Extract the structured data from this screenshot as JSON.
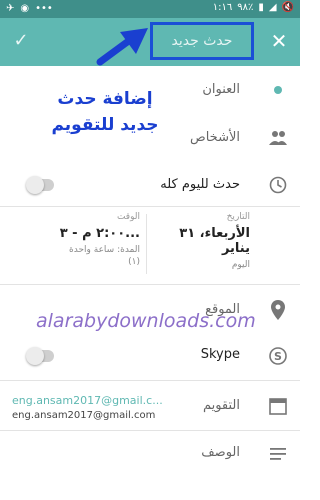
{
  "status_bar": {
    "time": "١:١٦",
    "battery": "٩٨٪"
  },
  "toolbar": {
    "title": "حدث جديد"
  },
  "annotation": {
    "line1": "إضافة حدث",
    "line2": "جديد للتقويم"
  },
  "fields": {
    "title_label": "العنوان",
    "people_label": "الأشخاص",
    "all_day_label": "حدث لليوم كله",
    "location_label": "الموقع",
    "skype_label": "Skype",
    "calendar_label": "التقويم",
    "description_label": "الوصف"
  },
  "datetime": {
    "date_caption": "التاريخ",
    "date_value": "الأربعاء، ٣١ يناير",
    "day_caption": "اليوم",
    "time_caption": "الوقت",
    "time_value": "٢:٠٠ م - ٣...",
    "duration": "المدة: ساعة واحدة",
    "repeat": "(١)"
  },
  "calendar": {
    "account_primary": "eng.ansam2017@gmail.c...",
    "account_secondary": "eng.ansam2017@gmail.com"
  },
  "watermark": "alarabydownloads.com",
  "colors": {
    "toolbar": "#5fb8b2",
    "status_bar": "#3f8f8a",
    "annotation": "#1a3fd0",
    "highlight_box": "#1a4fd6",
    "watermark": "#8c6fc9"
  }
}
